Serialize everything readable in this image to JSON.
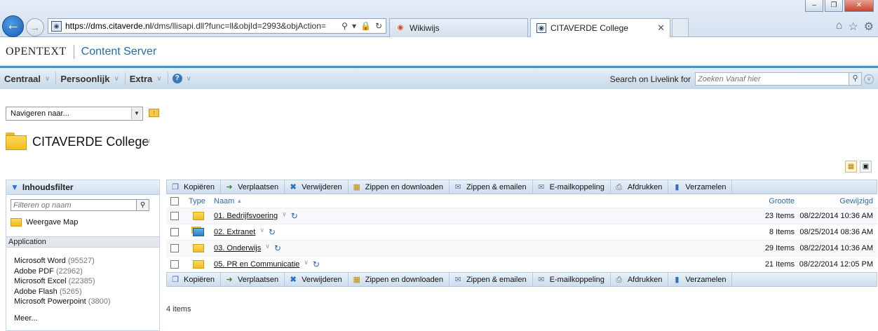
{
  "browser": {
    "url_host": "https://dms.citaverde.nl",
    "url_path": "/dms/llisapi.dll?func=ll&objId=2993&objAction=",
    "tabs": [
      {
        "label": "Wikiwijs",
        "active": false
      },
      {
        "label": "CITAVERDE College",
        "active": true
      }
    ]
  },
  "header": {
    "logo": "OPENTEXT",
    "product": "Content Server"
  },
  "menubar": {
    "items": [
      "Centraal",
      "Persoonlijk",
      "Extra"
    ],
    "search_label": "Search on Livelink for",
    "search_placeholder": "Zoeken Vanaf hier"
  },
  "navigate": {
    "select_value": "Navigeren naar..."
  },
  "page": {
    "title": "CITAVERDE College",
    "items_count": "4 items"
  },
  "filter": {
    "title": "Inhoudsfilter",
    "placeholder": "Filteren op naam",
    "view_map": "Weergave Map",
    "application_header": "Application",
    "applications": [
      {
        "name": "Microsoft Word",
        "count": "(95527)"
      },
      {
        "name": "Adobe PDF",
        "count": "(22962)"
      },
      {
        "name": "Microsoft Excel",
        "count": "(22385)"
      },
      {
        "name": "Adobe Flash",
        "count": "(5265)"
      },
      {
        "name": "Microsoft Powerpoint",
        "count": "(3800)"
      }
    ],
    "more": "Meer..."
  },
  "toolbar": {
    "copy": "Kopiëren",
    "move": "Verplaatsen",
    "delete": "Verwijderen",
    "zip_download": "Zippen en downloaden",
    "zip_email": "Zippen & emailen",
    "email_link": "E-mailkoppeling",
    "print": "Afdrukken",
    "collect": "Verzamelen"
  },
  "table": {
    "columns": {
      "type": "Type",
      "name": "Naam",
      "size": "Grootte",
      "modified": "Gewijzigd"
    },
    "rows": [
      {
        "name": "01. Bedrijfsvoering",
        "size": "23 Items",
        "modified": "08/22/2014 10:36 AM"
      },
      {
        "name": "02. Extranet",
        "size": "8 Items",
        "modified": "08/25/2014 08:36 AM"
      },
      {
        "name": "03. Onderwijs",
        "size": "29 Items",
        "modified": "08/22/2014 10:36 AM"
      },
      {
        "name": "05. PR en Communicatie",
        "size": "21 Items",
        "modified": "08/22/2014 12:05 PM"
      }
    ]
  }
}
